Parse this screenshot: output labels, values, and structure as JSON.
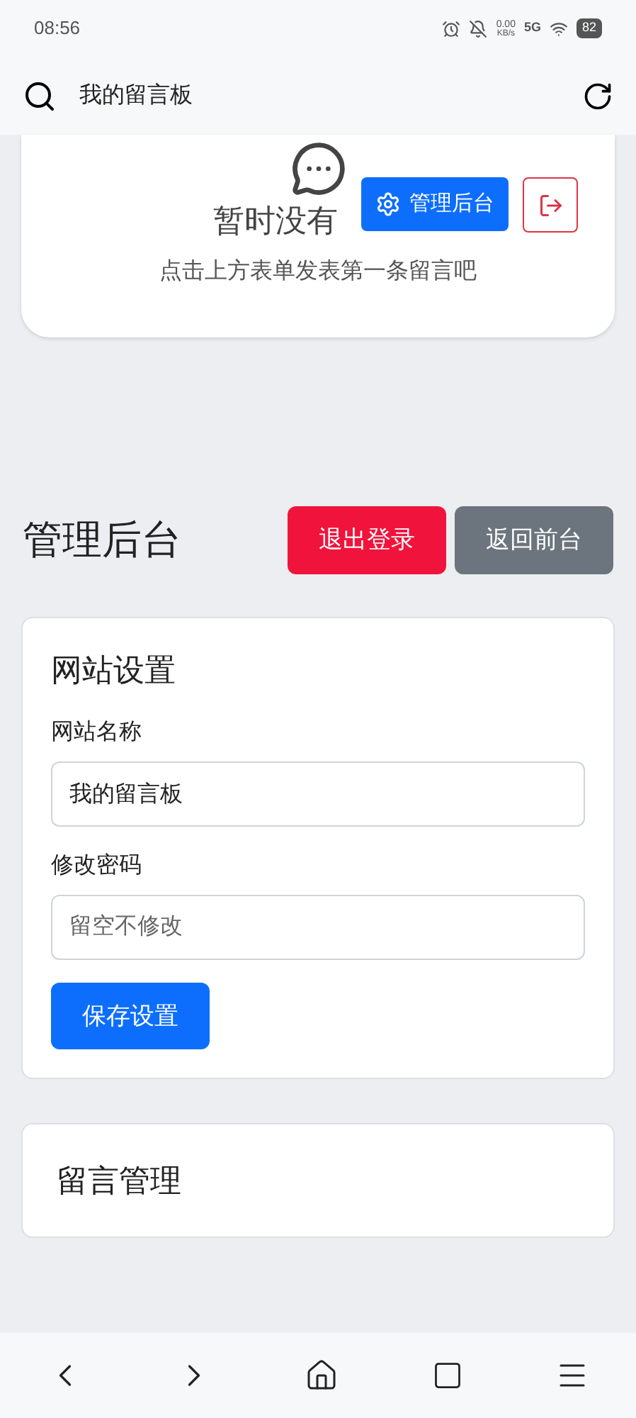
{
  "status_bar": {
    "time": "08:56",
    "speed": "0.00",
    "speed_unit": "KB/s",
    "network": "5G",
    "battery": "82"
  },
  "browser_bar": {
    "title": "我的留言板"
  },
  "empty_card": {
    "title": "暂时没有",
    "hint": "点击上方表单发表第一条留言吧"
  },
  "floating": {
    "admin_button": "管理后台"
  },
  "admin": {
    "heading": "管理后台",
    "buttons": [
      {
        "label": "退出登录",
        "kind": "danger"
      },
      {
        "label": "返回前台",
        "kind": "secondary"
      }
    ]
  },
  "settings": {
    "title": "网站设置",
    "fields": [
      {
        "label": "网站名称",
        "value": "我的留言板"
      },
      {
        "label": "修改密码",
        "placeholder": "留空不修改"
      }
    ],
    "save": "保存设置"
  },
  "messages": {
    "title": "留言管理"
  }
}
